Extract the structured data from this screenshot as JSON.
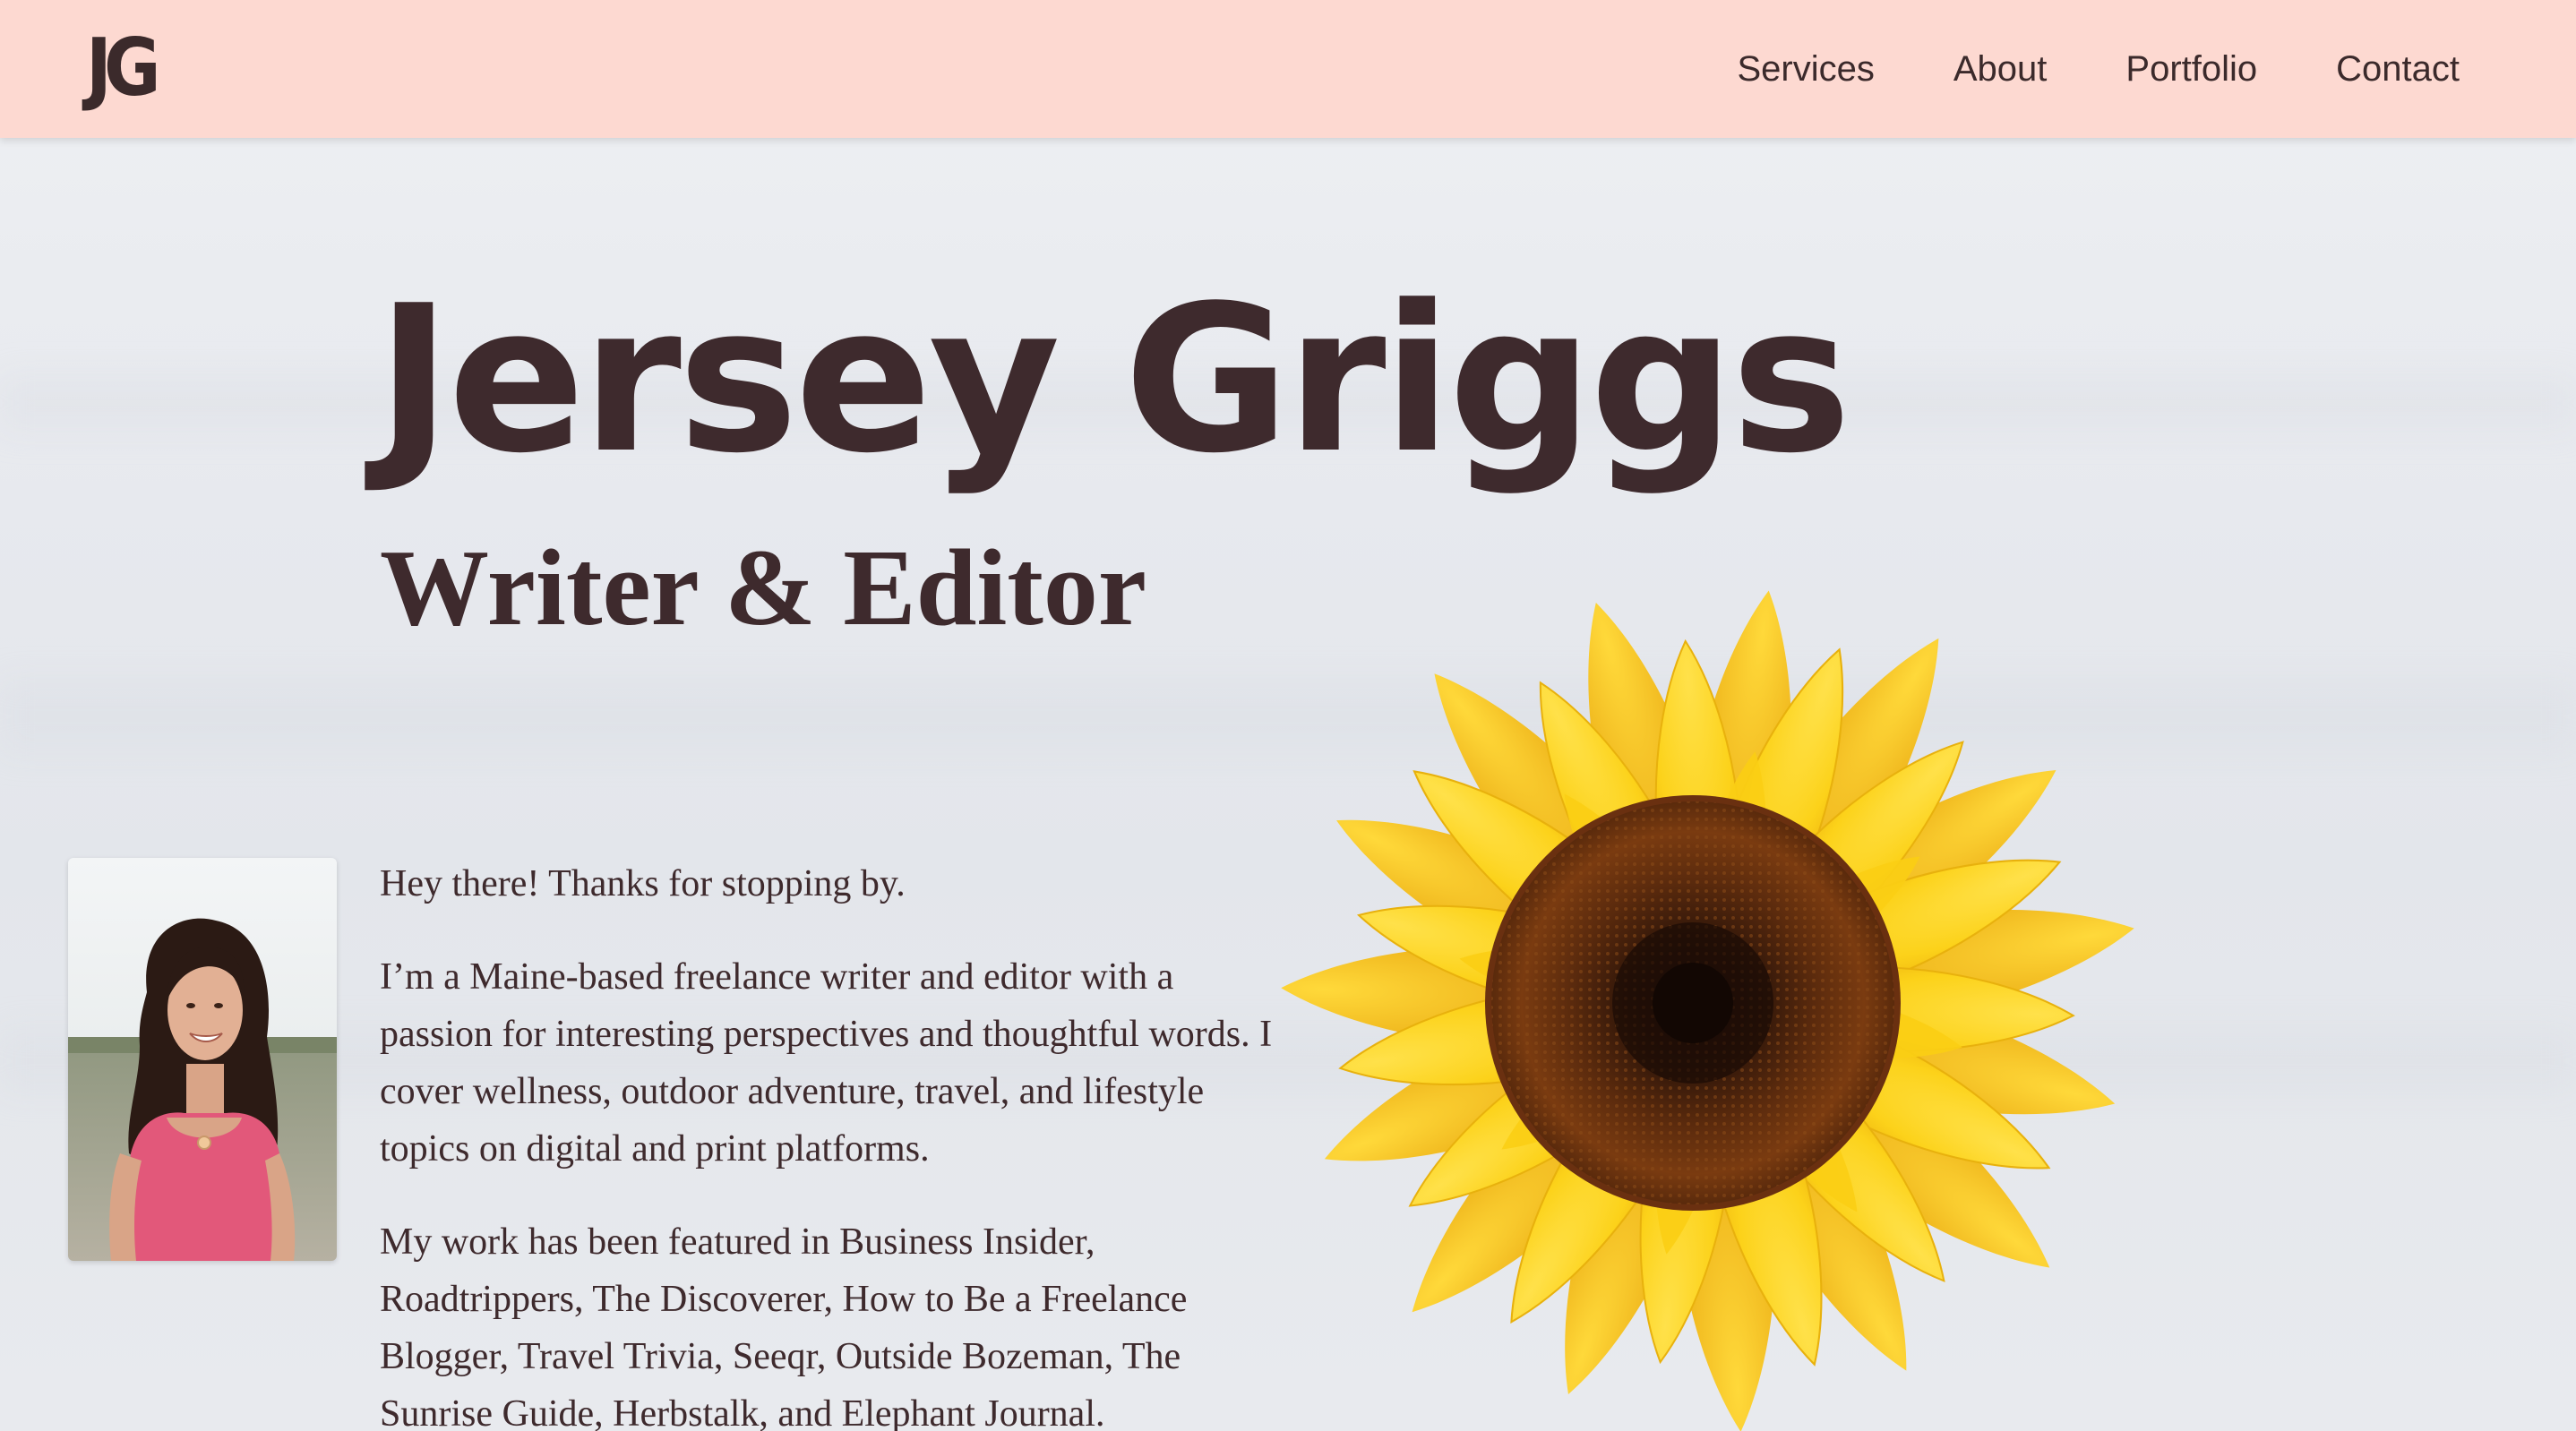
{
  "header": {
    "logo_text": "JG",
    "background": "#fdd9d1",
    "nav": [
      {
        "label": "Services"
      },
      {
        "label": "About"
      },
      {
        "label": "Portfolio"
      },
      {
        "label": "Contact"
      }
    ]
  },
  "hero": {
    "name": "Jersey Griggs",
    "subtitle": "Writer & Editor",
    "text_color": "#3e2a2d"
  },
  "intro": {
    "paragraphs": [
      "Hey there! Thanks for stopping by.",
      "I’m a Maine-based freelance writer and editor with a passion for interesting perspectives and thoughtful words. I cover wellness, outdoor adventure, travel, and lifestyle topics on digital and print platforms.",
      "My work has been featured in Business Insider, Roadtrippers, The Discoverer, How to Be a Freelance Blogger, Travel Trivia, Seeqr, Outside Bozeman, The Sunrise Guide, Herbstalk, and Elephant Journal."
    ]
  },
  "images": {
    "portrait": "portrait-photo",
    "sunflower": "sunflower-photo"
  }
}
